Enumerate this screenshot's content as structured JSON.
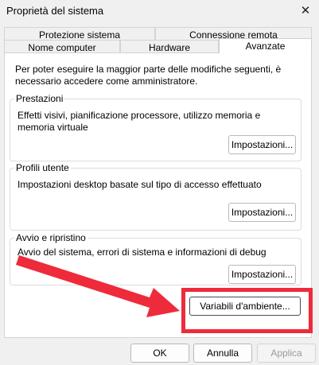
{
  "window": {
    "title": "Proprietà del sistema",
    "close_glyph": "✕"
  },
  "tabs_row1": [
    {
      "label": "Protezione sistema"
    },
    {
      "label": "Connessione remota"
    }
  ],
  "tabs_row2": [
    {
      "label": "Nome computer"
    },
    {
      "label": "Hardware"
    },
    {
      "label": "Avanzate",
      "active": true
    }
  ],
  "intro_text": "Per poter eseguire la maggior parte delle modifiche seguenti, è necessario accedere come amministratore.",
  "groups": {
    "performance": {
      "title": "Prestazioni",
      "description": "Effetti visivi, pianificazione processore, utilizzo memoria e memoria virtuale",
      "button": "Impostazioni..."
    },
    "user_profiles": {
      "title": "Profili utente",
      "description": "Impostazioni desktop basate sul tipo di accesso effettuato",
      "button": "Impostazioni..."
    },
    "startup_recovery": {
      "title": "Avvio e ripristino",
      "description": "Avvio del sistema, errori di sistema e informazioni di debug",
      "button": "Impostazioni..."
    }
  },
  "env_button": "Variabili d'ambiente...",
  "annotation_color": "#ee2b3b",
  "dialog_buttons": {
    "ok": "OK",
    "cancel": "Annulla",
    "apply": "Applica"
  }
}
